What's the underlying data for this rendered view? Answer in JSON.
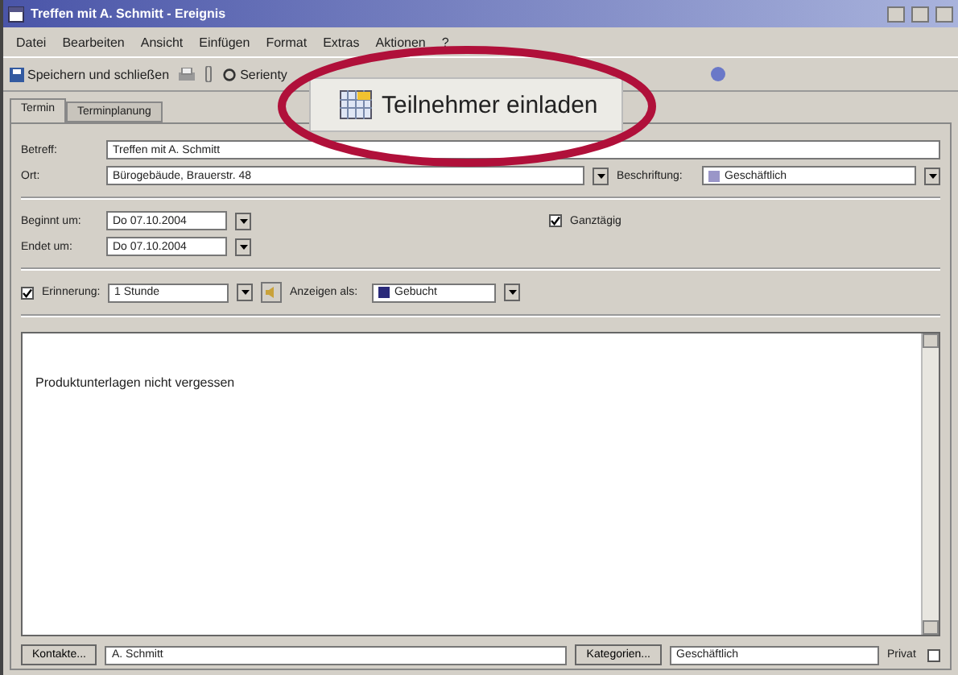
{
  "window": {
    "title": "Treffen mit A. Schmitt - Ereignis"
  },
  "menu": [
    "Datei",
    "Bearbeiten",
    "Ansicht",
    "Einfügen",
    "Format",
    "Extras",
    "Aktionen",
    "?"
  ],
  "toolbar": {
    "save": "Speichern und schließen",
    "recurrence": "Serienty"
  },
  "tabs": [
    {
      "label": "Termin",
      "selected": true
    },
    {
      "label": "Terminplanung",
      "selected": false
    }
  ],
  "form": {
    "subject_label": "Betreff:",
    "subject": "Treffen mit A. Schmitt",
    "location_label": "Ort:",
    "location": "Bürogebäude, Brauerstr. 48",
    "label_label": "Beschriftung:",
    "label_value": "Geschäftlich",
    "start_label": "Beginnt um:",
    "start": "Do 07.10.2004",
    "end_label": "Endet um:",
    "end": "Do 07.10.2004",
    "all_day_label": "Ganztägig",
    "all_day": true,
    "reminder_label": "Erinnerung:",
    "reminder": true,
    "reminder_value": "1 Stunde",
    "show_as_label": "Anzeigen als:",
    "show_as": "Gebucht"
  },
  "notes": "Produktunterlagen nicht vergessen",
  "footer": {
    "contacts_button": "Kontakte...",
    "contacts": "A. Schmitt",
    "categories_button": "Kategorien...",
    "categories": "Geschäftlich",
    "private_label": "Privat",
    "private": false
  },
  "callout": {
    "label": "Teilnehmer einladen"
  }
}
